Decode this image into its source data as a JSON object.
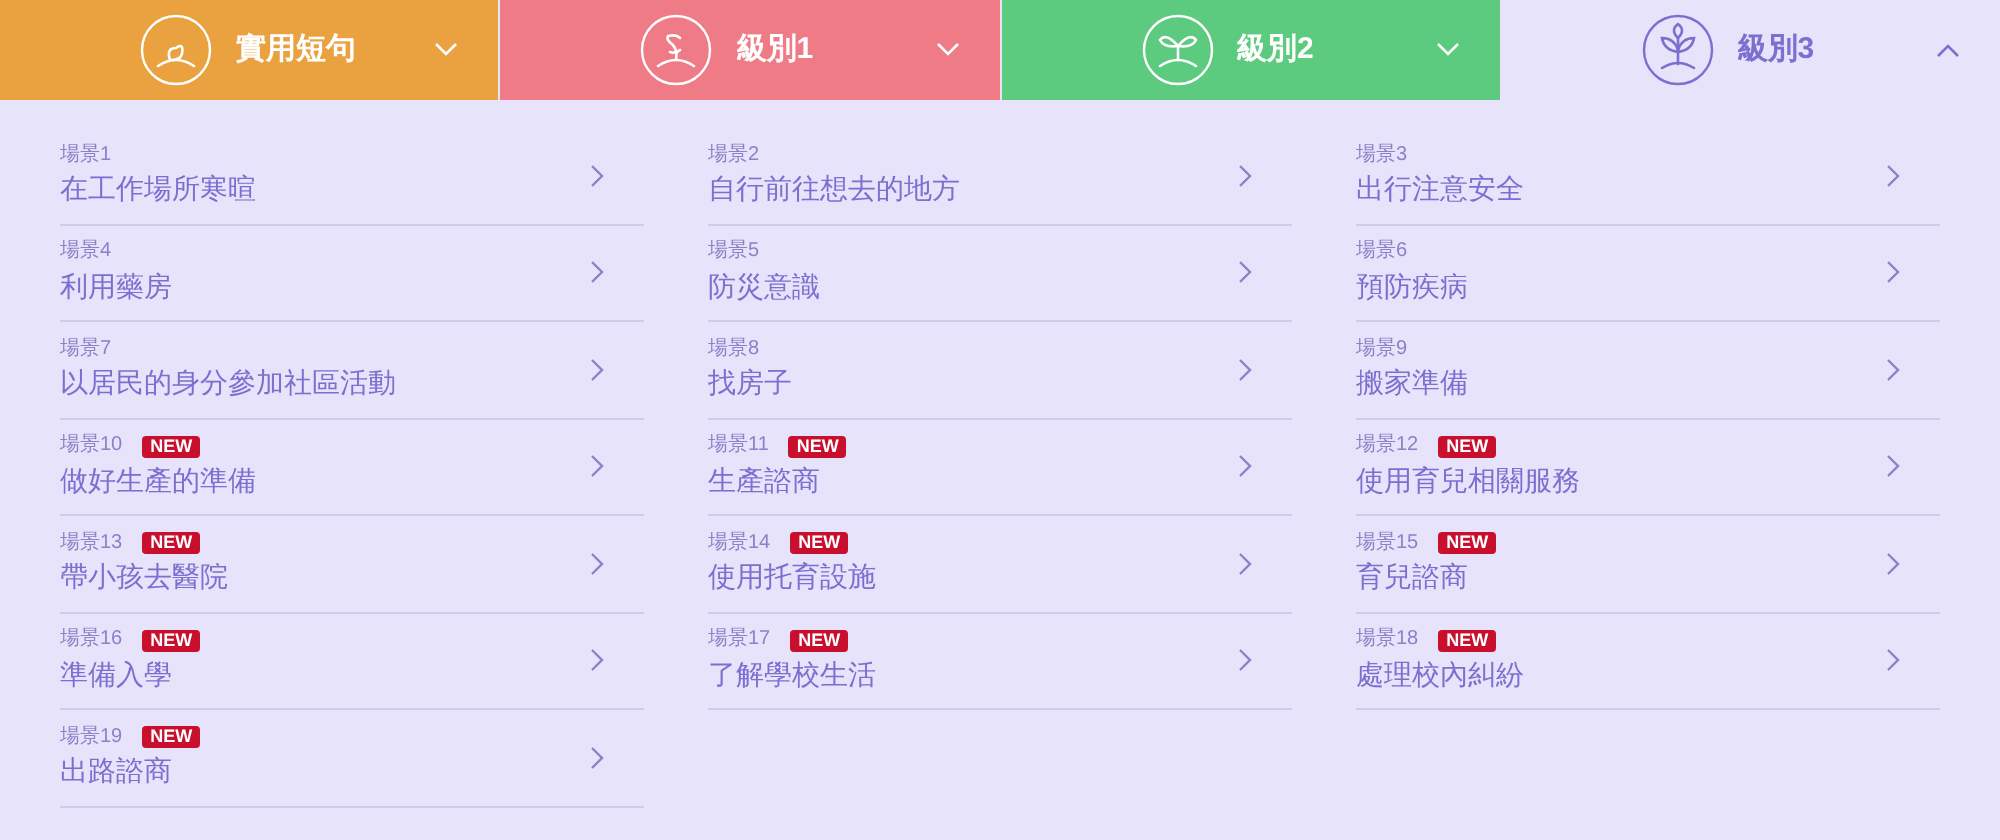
{
  "tabs": [
    {
      "label": "實用短句",
      "kind": "seed",
      "color": "#e9a23f",
      "selected": false,
      "expanded": false
    },
    {
      "label": "級別1",
      "kind": "sprout",
      "color": "#ef7b86",
      "selected": false,
      "expanded": false
    },
    {
      "label": "級別2",
      "kind": "seedling",
      "color": "#5ccb7f",
      "selected": false,
      "expanded": false
    },
    {
      "label": "級別3",
      "kind": "plant",
      "color": "#e6e3fa",
      "selected": true,
      "expanded": true
    }
  ],
  "scenes": [
    {
      "label": "場景1",
      "title": "在工作場所寒暄",
      "new": false
    },
    {
      "label": "場景2",
      "title": "自行前往想去的地方",
      "new": false
    },
    {
      "label": "場景3",
      "title": "出行注意安全",
      "new": false
    },
    {
      "label": "場景4",
      "title": "利用藥房",
      "new": false
    },
    {
      "label": "場景5",
      "title": "防災意識",
      "new": false
    },
    {
      "label": "場景6",
      "title": "預防疾病",
      "new": false
    },
    {
      "label": "場景7",
      "title": "以居民的身分參加社區活動",
      "new": false
    },
    {
      "label": "場景8",
      "title": "找房子",
      "new": false
    },
    {
      "label": "場景9",
      "title": "搬家準備",
      "new": false
    },
    {
      "label": "場景10",
      "title": "做好生產的準備",
      "new": true,
      "badge": "NEW"
    },
    {
      "label": "場景11",
      "title": "生產諮商",
      "new": true,
      "badge": "NEW"
    },
    {
      "label": "場景12",
      "title": "使用育兒相關服務",
      "new": true,
      "badge": "NEW"
    },
    {
      "label": "場景13",
      "title": "帶小孩去醫院",
      "new": true,
      "badge": "NEW"
    },
    {
      "label": "場景14",
      "title": "使用托育設施",
      "new": true,
      "badge": "NEW"
    },
    {
      "label": "場景15",
      "title": "育兒諮商",
      "new": true,
      "badge": "NEW"
    },
    {
      "label": "場景16",
      "title": "準備入學",
      "new": true,
      "badge": "NEW"
    },
    {
      "label": "場景17",
      "title": "了解學校生活",
      "new": true,
      "badge": "NEW"
    },
    {
      "label": "場景18",
      "title": "處理校內糾紛",
      "new": true,
      "badge": "NEW"
    },
    {
      "label": "場景19",
      "title": "出路諮商",
      "new": true,
      "badge": "NEW"
    }
  ]
}
